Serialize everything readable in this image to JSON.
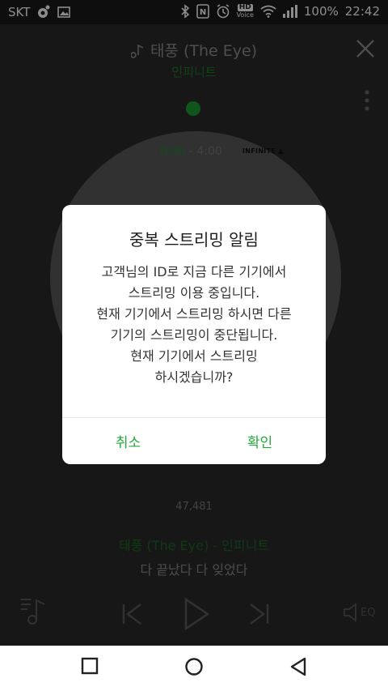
{
  "status_bar": {
    "carrier": "SKT",
    "hd_label": "HD",
    "voice_label": "Voice",
    "battery": "100%",
    "time": "22:42"
  },
  "player": {
    "song_title": "태풍 (The Eye)",
    "artist": "인피니트",
    "current_time": "0:00",
    "separator": " - ",
    "total_time": "4:00",
    "album_label": "INFINITE ▲",
    "like_count": "47,481",
    "now_playing": "태풍 (The Eye) - 인피니트",
    "lyric": "다 끝났다 다 잊었다",
    "eq_label": "EQ"
  },
  "dialog": {
    "title": "중복 스트리밍 알림",
    "body_lines": [
      "고객님의 ID로 지금 다른 기기에서",
      "스트리밍 이용 중입니다.",
      "현재 기기에서 스트리밍 하시면 다른",
      "기기의 스트리밍이 중단됩니다.",
      "현재 기기에서 스트리밍",
      "하시겠습니까?"
    ],
    "cancel_label": "취소",
    "confirm_label": "확인"
  },
  "colors": {
    "accent": "#25a83b",
    "dim_green": "#1c6a25"
  }
}
